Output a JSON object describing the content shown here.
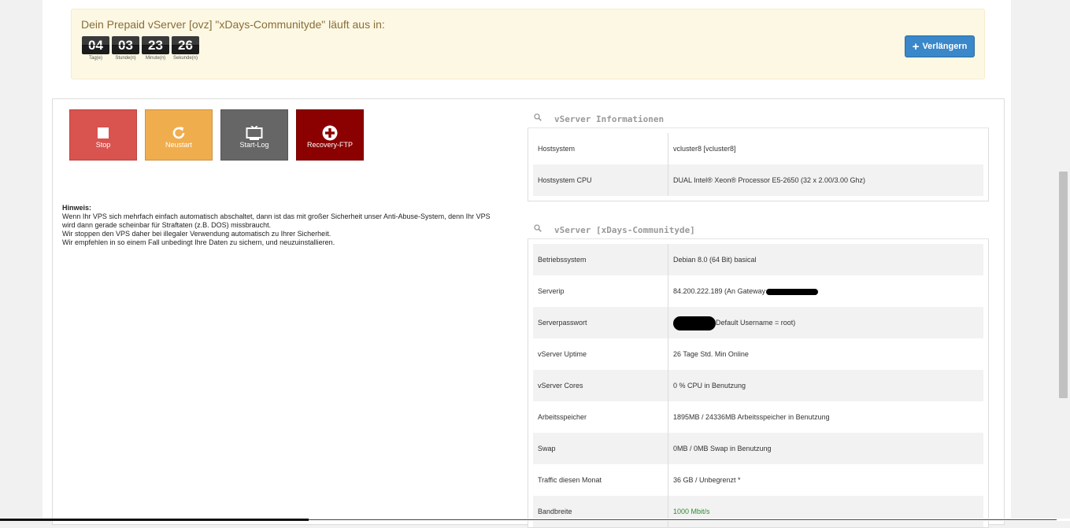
{
  "alert": {
    "title": "Dein Prepaid vServer [ovz] \"xDays-Communityde\" läuft aus in:",
    "countdown": [
      {
        "value": "04",
        "label": "Tag(e)"
      },
      {
        "value": "03",
        "label": "Stunde(n)"
      },
      {
        "value": "23",
        "label": "Minute(n)"
      },
      {
        "value": "26",
        "label": "Sekunde(n)"
      }
    ],
    "extend_label": "Verlängern"
  },
  "actions": {
    "stop": "Stop",
    "restart": "Neustart",
    "startlog": "Start-Log",
    "recovery": "Recovery-FTP"
  },
  "hint": {
    "title": "Hinweis:",
    "lines": [
      "Wenn Ihr VPS sich mehrfach einfach automatisch abschaltet, dann ist das mit großer Sicherheit unser Anti-Abuse-System, denn Ihr VPS",
      "wird dann gerade scheinbar für Straftaten (z.B. DOS) missbraucht.",
      "Wir stoppen den VPS daher bei illegaler Verwendung automatisch zu Ihrer Sicherheit.",
      "Wir empfehlen in so einem Fall unbedingt Ihre Daten zu sichern, und neuzuinstallieren."
    ]
  },
  "info": {
    "title": "vServer Informationen",
    "rows": [
      {
        "key": "Hostsystem",
        "value": "vcluster8 [vcluster8]"
      },
      {
        "key": "Hostsystem CPU",
        "value": "DUAL Intel® Xeon® Processor E5-2650 (32 x 2.00/3.00 Ghz)"
      }
    ]
  },
  "vserver": {
    "title": "vServer [xDays-Communityde]",
    "rows": [
      {
        "key": "Betriebssystem",
        "value": "Debian 8.0 (64 Bit) basical"
      },
      {
        "key": "Serverip",
        "value": "84.200.222.189 (An Gateway"
      },
      {
        "key": "Serverpasswort",
        "value": "Default Username = root)"
      },
      {
        "key": "vServer Uptime",
        "value": "26 Tage Std. Min Online"
      },
      {
        "key": "vServer Cores",
        "value": "0 % CPU in Benutzung"
      },
      {
        "key": "Arbeitsspeicher",
        "value": "1895MB / 24336MB Arbeitsspeicher in Benutzung"
      },
      {
        "key": "Swap",
        "value": "0MB / 0MB Swap in Benutzung"
      },
      {
        "key": "Traffic diesen Monat",
        "value": "36 GB / Unbegrenzt *"
      },
      {
        "key": "Bandbreite",
        "value": "1000 Mbit/s"
      }
    ]
  },
  "colors": {
    "stop": "#d9534f",
    "restart": "#f0ad4e",
    "startlog": "#666666",
    "recovery": "#8b0000",
    "extend": "#3a87c9",
    "bandwidth": "#2e8b2e"
  }
}
